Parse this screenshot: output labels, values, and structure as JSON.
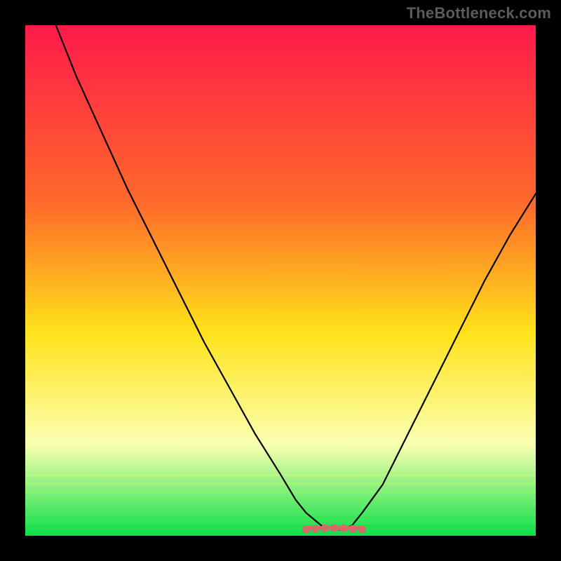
{
  "watermark": "TheBottleneck.com",
  "colors": {
    "background": "#000000",
    "curve": "#000000",
    "marker": "#d46a6a",
    "gradient_top": "#ff1a4b",
    "gradient_mid1": "#ff7a2a",
    "gradient_mid2": "#ffe21a",
    "gradient_low": "#fbffb0",
    "gradient_bottom": "#0fe04a"
  },
  "chart_data": {
    "type": "line",
    "title": "",
    "xlabel": "",
    "ylabel": "",
    "xlim": [
      0,
      100
    ],
    "ylim": [
      0,
      100
    ],
    "series": [
      {
        "name": "curve",
        "x": [
          6,
          10,
          15,
          20,
          25,
          30,
          35,
          40,
          45,
          50,
          53,
          55,
          58,
          60,
          62,
          64,
          66,
          70,
          75,
          80,
          85,
          90,
          95,
          100
        ],
        "y": [
          100,
          90,
          79,
          68,
          58,
          48,
          38,
          29,
          20,
          12,
          7,
          4.5,
          2,
          1.2,
          1.2,
          2,
          4.5,
          10,
          20,
          30,
          40,
          50,
          59,
          67
        ]
      }
    ],
    "markers": {
      "name": "bottom-marker",
      "x_range": [
        55,
        66
      ],
      "y": 1.5
    },
    "gradient_layers": [
      {
        "y": 0,
        "color": "#ff1a4b"
      },
      {
        "y": 35,
        "color": "#ff6a2a"
      },
      {
        "y": 60,
        "color": "#ffe21a"
      },
      {
        "y": 82,
        "color": "#fbffb0"
      },
      {
        "y": 100,
        "color": "#0fe04a"
      }
    ]
  }
}
